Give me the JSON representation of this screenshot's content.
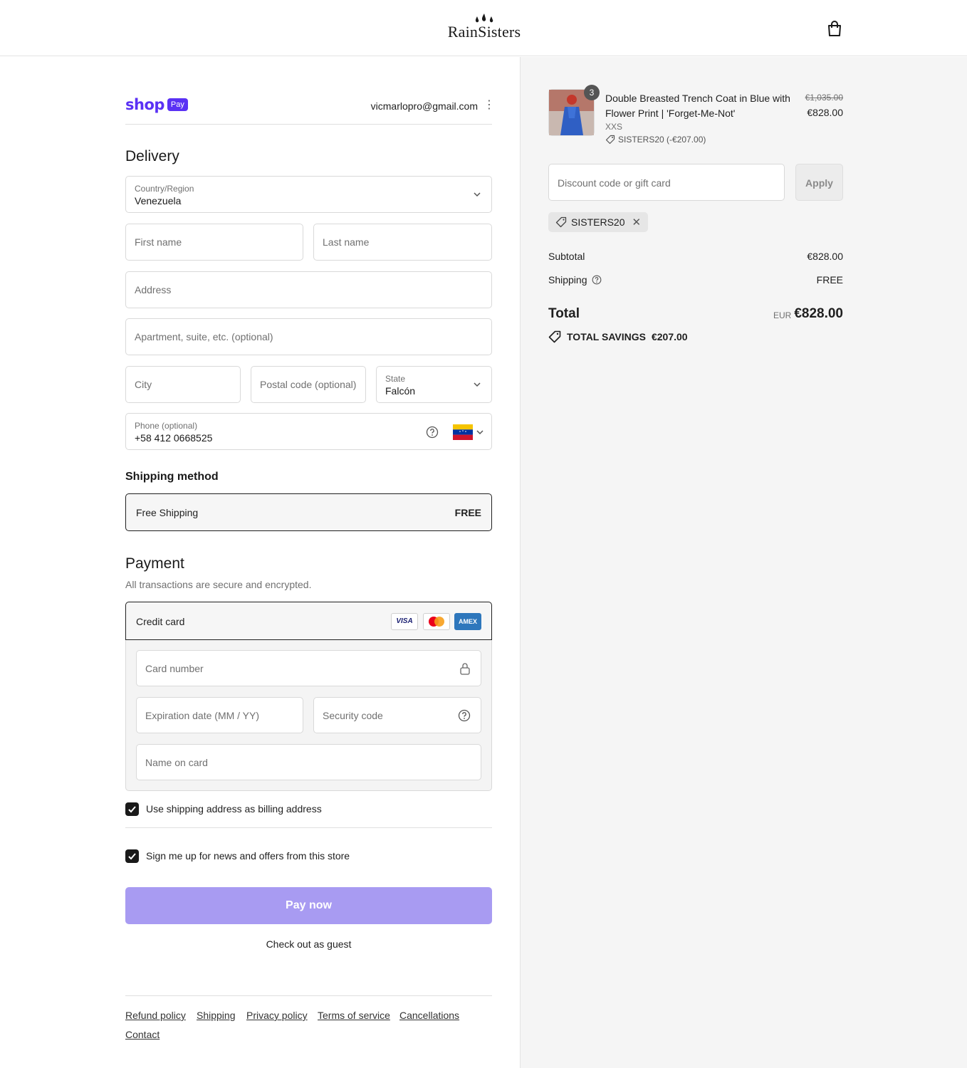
{
  "header": {
    "brand": "RainSisters",
    "cart_icon": "shopping-bag-icon"
  },
  "shop_pay": {
    "shop_word": "shop",
    "pay_badge": "Pay",
    "email": "vicmarlopro@gmail.com"
  },
  "delivery": {
    "title": "Delivery",
    "country_label": "Country/Region",
    "country_value": "Venezuela",
    "first_name_placeholder": "First name",
    "last_name_placeholder": "Last name",
    "address_placeholder": "Address",
    "apartment_placeholder": "Apartment, suite, etc. (optional)",
    "city_placeholder": "City",
    "postal_placeholder": "Postal code (optional)",
    "state_label": "State",
    "state_value": "Falcón",
    "phone_label": "Phone (optional)",
    "phone_value": "+58 412 0668525"
  },
  "shipping_method": {
    "title": "Shipping method",
    "option_name": "Free Shipping",
    "option_price": "FREE"
  },
  "payment": {
    "title": "Payment",
    "subtitle": "All transactions are secure and encrypted.",
    "method": "Credit card",
    "card_logos": [
      "VISA",
      "mastercard",
      "AMEX"
    ],
    "card_number_placeholder": "Card number",
    "expiry_placeholder": "Expiration date (MM / YY)",
    "security_placeholder": "Security code",
    "name_placeholder": "Name on card"
  },
  "checkboxes": {
    "billing_same": "Use shipping address as billing address",
    "newsletter": "Sign me up for news and offers from this store"
  },
  "pay_button": "Pay now",
  "guest_link": "Check out as guest",
  "footer_links": [
    "Refund policy",
    "Shipping",
    "Privacy policy",
    "Terms of service",
    "Cancellations",
    "Contact"
  ],
  "summary": {
    "product": {
      "quantity": "3",
      "name": "Double Breasted Trench Coat in Blue with Flower Print | 'Forget-Me-Not'",
      "variant": "XXS",
      "discount_line": "SISTERS20 (-€207.00)",
      "original_price": "€1,035.00",
      "price": "€828.00"
    },
    "discount_placeholder": "Discount code or gift card",
    "apply_label": "Apply",
    "applied_code": "SISTERS20",
    "subtotal_label": "Subtotal",
    "subtotal_value": "€828.00",
    "shipping_label": "Shipping",
    "shipping_value": "FREE",
    "total_label": "Total",
    "total_currency": "EUR",
    "total_value": "€828.00",
    "savings_label": "TOTAL SAVINGS",
    "savings_value": "€207.00"
  },
  "colors": {
    "shop_purple": "#5a31f4",
    "pay_button": "#a89bf2",
    "summary_bg": "#f5f5f5"
  }
}
